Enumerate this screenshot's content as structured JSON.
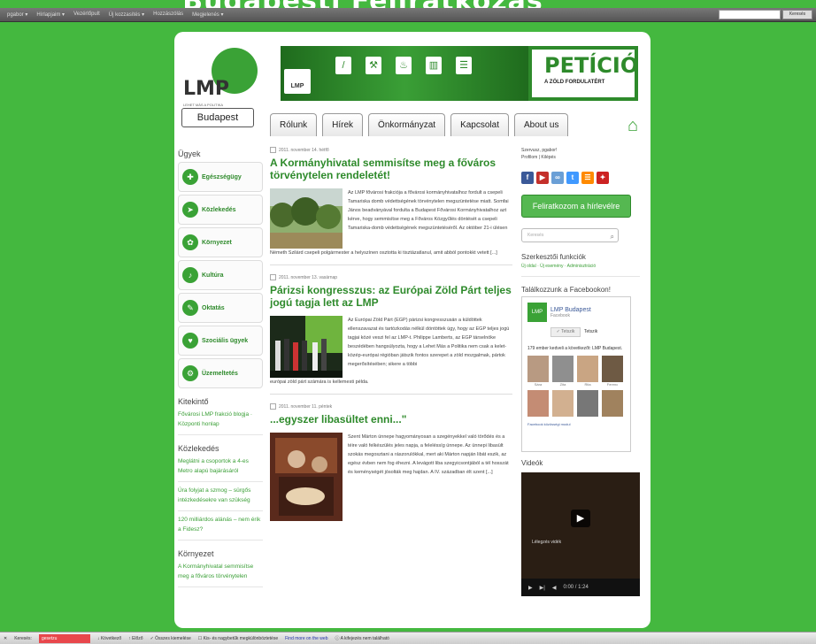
{
  "banner": {
    "text": "Budapesti Feliratkozás"
  },
  "topbar": {
    "menu": [
      "pgabor ▾",
      "Hírlapjaim ▾",
      "Vezérlőpult",
      "Új kozzasítés ▾",
      "Hozzászólás",
      "Megjelenés ▾"
    ],
    "search_button": "Keresés"
  },
  "site": {
    "logo_text": "LMP",
    "logo_tagline": "LEHET MÁS A POLITIKA",
    "city": "Budapest",
    "hero_mini": "LMP",
    "hero_icons": [
      "/",
      "⚒",
      "♨",
      "▥",
      "☰"
    ],
    "petition_title": "PETÍCIÓ",
    "petition_sub": "A ZÖLD FORDULATÉRT"
  },
  "nav": {
    "tabs": [
      "Rólunk",
      "Hírek",
      "Önkormányzat",
      "Kapcsolat",
      "About us"
    ]
  },
  "left": {
    "heading": "Ügyek",
    "categories": [
      "Egészségügy",
      "Közlekedés",
      "Környezet",
      "Kultúra",
      "Oktatás",
      "Szociális ügyek",
      "Üzemeltetés"
    ],
    "sections": [
      {
        "title": "Kitekintő",
        "text": "Fővárosi LMP frakció blogja · Központi honlap"
      },
      {
        "title": "Közlekedés",
        "text": "Meglátni a csoportok a 4-es Metro alapú bajárásáról"
      },
      {
        "title": "",
        "text": "Úra folyjat a szmog – sürgős intézkedésekre van szükség"
      },
      {
        "title": "",
        "text": "120 milliárdos alánás – nem érik a Fidesz?"
      },
      {
        "title": "Környezet",
        "text": "A Kormányhivatal semmisítse meg a főváros törvénytelen"
      }
    ]
  },
  "articles": [
    {
      "date": "2011. november 14. hétfő",
      "title": "A Kormányhivatal semmisítse meg a főváros törvénytelen rendeletét!",
      "text": "Az LMP fővárosi frakciója a fővárosi kormányhivatalhoz fordult a csepeli Tamariska domb védettségének törvénytelen megszüntetése miatt. Somfai János beadványával fordulta a Budapest Fővárosi Kormányhivatalhoz azt kérve, hogy semmisítse meg a Főváros Közgyűlés döntését a csepeli Tamariska-domb védettségének megszüntetéséről. Az október 21-i ülésen",
      "tail": "Németh Szilárd csepeli polgármester a helyszínen osztotta ki tisztázatlanul, amit abból pontokkt vetett [...]",
      "image": "Forest"
    },
    {
      "date": "2011. november 13. vasárnap",
      "title": "Párizsi kongresszus: az Európai Zöld Párt teljes jogú tagja lett az LMP",
      "text": "Az Európai Zöld Párt (EGP) párizsi kongresszusán a küldöttek ellenszavazat és tartózkodás nélkül döntöttek úgy, hogy az EGP teljes jogú tagjai közé veszi fel az LMP-t. Philippe Lamberts, az EGP társelnöke beszédében hangsúlyozta, hogy a Lehet Más a Politika nem csak a kelet-közép-európai régióban játszik fontos szerepet a zöld mozgalmak, pártok megerősítésében; sikere a többi",
      "tail": "európai zöld párt számára is kellemesti példa.",
      "image": "Congress"
    },
    {
      "date": "2011. november 11. péntek",
      "title": "...egyszer libasültet enni...\"",
      "text": "Szent Márton ünnepe hagyományosan a szegényekkel való törődés és a téire való felkészülés jeles napja, a feleléssíg ünnepe. Az ünnepi libasült szokás megosztani a rászorulókkal, mert aki Márton napján libát eszik, az egész évben nem fog éhezni. A levágott liba szegyicsontjából a tél hosszát és keménységét jósolták meg hajdan. A IV. században élt szent [...]",
      "tail": "",
      "image": "Painting"
    }
  ],
  "right": {
    "greeting": "Szervusz, pgabor!",
    "profile": "Profilom | Kilépés",
    "social": [
      "f",
      "▶",
      "∞",
      "t",
      "☰",
      "✦"
    ],
    "social_colors": [
      "#3b5998",
      "#c4302b",
      "#6a9fd6",
      "#4099ff",
      "#ff8a00",
      "#cc2222"
    ],
    "subscribe": "Feliratkozom a hírlevélre",
    "search_placeholder": "Keresés",
    "editor_title": "Szerkesztői funkciók",
    "editor_links": "Új oldal · Új esemény · Adminisztráció",
    "fb_title": "Találkozzunk a Facebookon!",
    "fb_page": "LMP Budapest",
    "fb_page_sub": "Facebook",
    "fb_like": "✓ Tetszik",
    "fb_like_text": "Tetszik",
    "fb_fans": "179 ember kedveli a következőt: LMP Budapest.",
    "fb_faces": [
      "Sára",
      "Zita",
      "Rita",
      "Ferenc"
    ],
    "fb_plugin": "Facebook közösségi modul",
    "videos_title": "Videók",
    "video_title": "Lélegzés vidék",
    "video_time": "0:00 / 1:24"
  },
  "statusbar": {
    "close": "✕",
    "find_label": "Keresés:",
    "find_value": "gesetzu",
    "next": "↓ Következő",
    "prev": "↑ Előző",
    "highlight": "✓ Összes kiemelése",
    "case": "☐ Kis- és nagybetűk megkülönböztetése",
    "web": "Find more on the web",
    "notfound": "ⓘ A kifejezés nem található"
  },
  "colors": {
    "page_bg": "#44b83f",
    "brand_green": "#2e8a2b",
    "link_green": "#3a9f36"
  }
}
